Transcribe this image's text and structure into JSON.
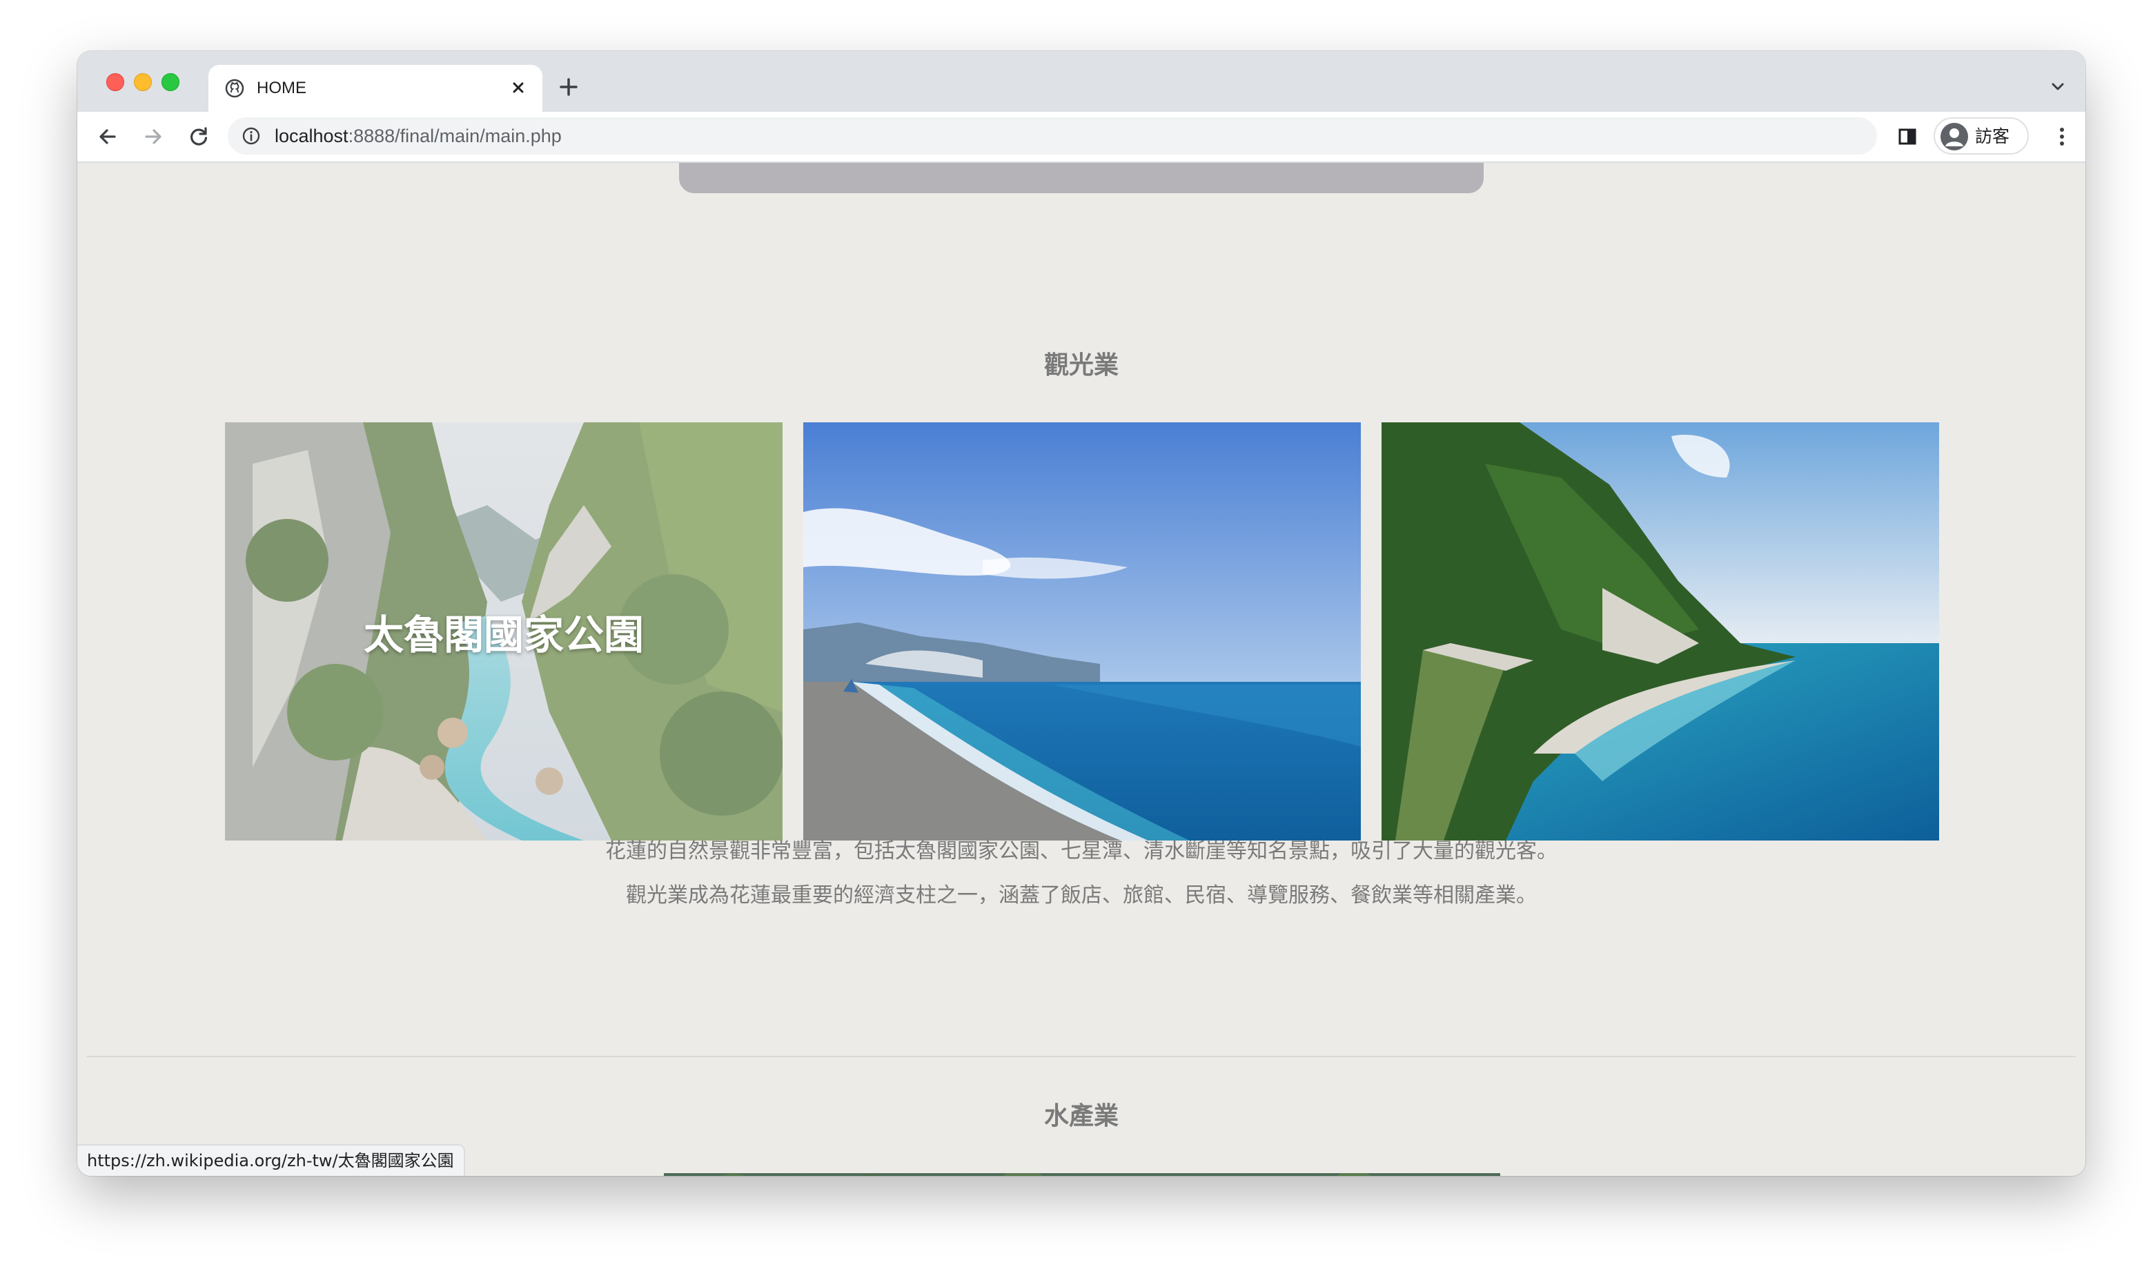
{
  "browser": {
    "tab_title": "HOME",
    "url_host": "localhost",
    "url_rest": ":8888/final/main/main.php",
    "profile_label": "訪客",
    "status_url": "https://zh.wikipedia.org/zh-tw/太魯閣國家公園"
  },
  "page": {
    "tourism": {
      "title": "觀光業",
      "photos": [
        {
          "name": "taroko-gorge",
          "caption": "太魯閣國家公園"
        },
        {
          "name": "qixingtan-beach",
          "caption": ""
        },
        {
          "name": "qingshui-cliff",
          "caption": ""
        }
      ],
      "description": "花蓮的自然景觀非常豐富，包括太魯閣國家公園、七星潭、清水斷崖等知名景點，吸引了大量的觀光客。 觀光業成為花蓮最重要的經濟支柱之一，涵蓋了飯店、旅館、民宿、導覽服務、餐飲業等相關產業。"
    },
    "fishery": {
      "title": "水產業"
    }
  },
  "icons": {
    "favicon": "github-logo-icon",
    "back": "arrow-left-icon",
    "forward": "arrow-right-icon",
    "reload": "reload-icon",
    "info": "info-icon",
    "sidepanel": "side-panel-icon",
    "avatar": "avatar-icon",
    "menu": "kebab-menu-icon",
    "tab_search": "chevron-down-icon"
  }
}
